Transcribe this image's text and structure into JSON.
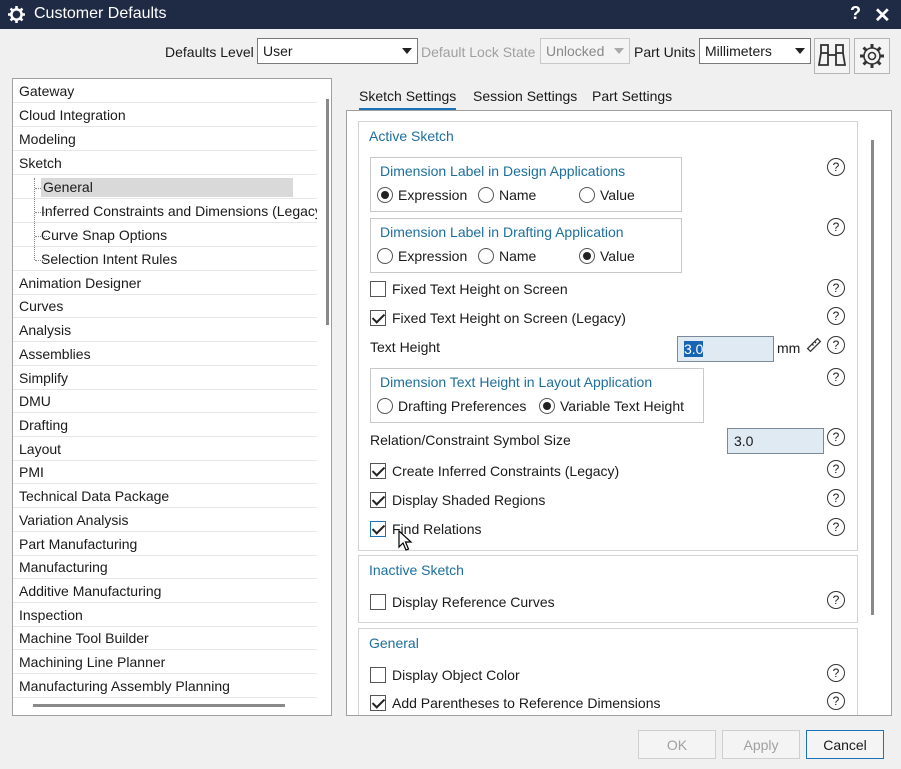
{
  "window": {
    "title": "Customer Defaults",
    "help_label": "?",
    "close_label": "✕",
    "app_icon": "gear-icon"
  },
  "toolbar": {
    "defaults_level_label": "Defaults Level",
    "defaults_level_value": "User",
    "lock_state_label": "Default Lock State",
    "lock_state_value": "Unlocked",
    "part_units_label": "Part Units",
    "part_units_value": "Millimeters",
    "find_icon": "binoculars-icon",
    "settings_icon": "gear-icon"
  },
  "tree": {
    "items": [
      {
        "label": "Gateway"
      },
      {
        "label": "Cloud Integration"
      },
      {
        "label": "Modeling"
      },
      {
        "label": "Sketch"
      },
      {
        "label": "General"
      },
      {
        "label": "Inferred Constraints and Dimensions (Legacy)"
      },
      {
        "label": "Curve Snap Options"
      },
      {
        "label": "Selection Intent Rules"
      },
      {
        "label": "Animation Designer"
      },
      {
        "label": "Curves"
      },
      {
        "label": "Analysis"
      },
      {
        "label": "Assemblies"
      },
      {
        "label": "Simplify"
      },
      {
        "label": "DMU"
      },
      {
        "label": "Drafting"
      },
      {
        "label": "Layout"
      },
      {
        "label": "PMI"
      },
      {
        "label": "Technical Data Package"
      },
      {
        "label": "Variation Analysis"
      },
      {
        "label": "Part Manufacturing"
      },
      {
        "label": "Manufacturing"
      },
      {
        "label": "Additive Manufacturing"
      },
      {
        "label": "Inspection"
      },
      {
        "label": "Machine Tool Builder"
      },
      {
        "label": "Machining Line Planner"
      },
      {
        "label": "Manufacturing Assembly Planning"
      }
    ],
    "selected": "General"
  },
  "tabs": [
    {
      "label": "Sketch Settings",
      "active": true
    },
    {
      "label": "Session Settings",
      "active": false
    },
    {
      "label": "Part Settings",
      "active": false
    }
  ],
  "active_sketch": {
    "title": "Active Sketch",
    "design_group": {
      "title": "Dimension Label in Design Applications",
      "options": [
        "Expression",
        "Name",
        "Value"
      ],
      "selected": "Expression"
    },
    "drafting_group": {
      "title": "Dimension Label in Drafting Application",
      "options": [
        "Expression",
        "Name",
        "Value"
      ],
      "selected": "Value"
    },
    "fixed_text_height": {
      "label": "Fixed Text Height on Screen",
      "checked": false
    },
    "fixed_text_height_legacy": {
      "label": "Fixed Text Height on Screen (Legacy)",
      "checked": true
    },
    "text_height": {
      "label": "Text Height",
      "value": "3.0",
      "unit": "mm",
      "unit_icon": "ruler-icon"
    },
    "layout_group": {
      "title": "Dimension Text Height in Layout Application",
      "options": [
        "Drafting Preferences",
        "Variable Text Height"
      ],
      "selected": "Variable Text Height"
    },
    "symbol_size": {
      "label": "Relation/Constraint Symbol Size",
      "value": "3.0"
    },
    "create_inferred": {
      "label": "Create Inferred Constraints (Legacy)",
      "checked": true
    },
    "display_shaded": {
      "label": "Display Shaded Regions",
      "checked": true
    },
    "find_relations": {
      "label": "Find Relations",
      "checked": true
    }
  },
  "inactive_sketch": {
    "title": "Inactive Sketch",
    "display_reference_curves": {
      "label": "Display Reference Curves",
      "checked": false
    }
  },
  "general": {
    "title": "General",
    "display_object_color": {
      "label": "Display Object Color",
      "checked": false
    },
    "add_parentheses": {
      "label": "Add Parentheses to Reference Dimensions",
      "checked": true
    }
  },
  "help_glyph": "?",
  "buttons": {
    "ok": "OK",
    "apply": "Apply",
    "cancel": "Cancel"
  },
  "colors": {
    "titlebar": "#1f2a44",
    "section_title": "#1d6f9e",
    "accent": "#1a73b8"
  }
}
